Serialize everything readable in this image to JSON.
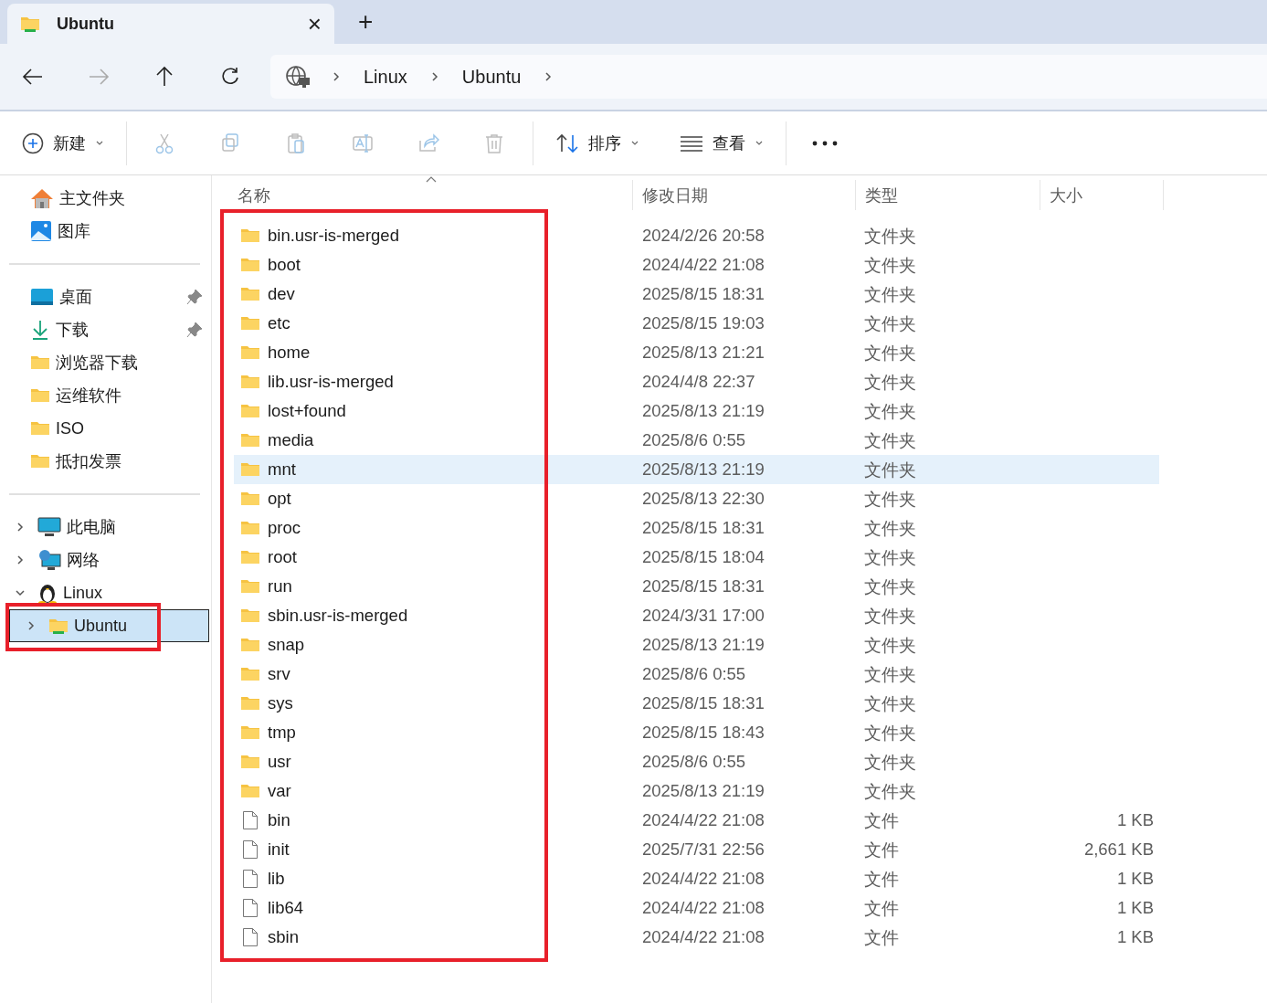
{
  "tab": {
    "title": "Ubuntu",
    "close": "×",
    "new_tab": "+"
  },
  "navigation": {
    "forward_disabled": true
  },
  "breadcrumb": [
    "Linux",
    "Ubuntu"
  ],
  "toolbar": {
    "new": "新建",
    "sort": "排序",
    "view": "查看",
    "actions": [
      {
        "kind": "cut",
        "disabled": true
      },
      {
        "kind": "copy",
        "disabled": true
      },
      {
        "kind": "paste",
        "disabled": true
      },
      {
        "kind": "rename",
        "disabled": true
      },
      {
        "kind": "share",
        "disabled": true
      },
      {
        "kind": "delete",
        "disabled": true
      }
    ]
  },
  "sidebar": {
    "top": [
      {
        "label": "主文件夹",
        "kind": "home"
      },
      {
        "label": "图库",
        "kind": "gallery"
      }
    ],
    "quick_access": [
      {
        "label": "桌面",
        "kind": "desktop",
        "pinned": true
      },
      {
        "label": "下载",
        "kind": "download",
        "pinned": true
      },
      {
        "label": "浏览器下载",
        "kind": "folder",
        "pinned": false
      },
      {
        "label": "运维软件",
        "kind": "folder",
        "pinned": false
      },
      {
        "label": "ISO",
        "kind": "folder",
        "pinned": false
      },
      {
        "label": "抵扣发票",
        "kind": "folder",
        "pinned": false
      }
    ],
    "tree": [
      {
        "label": "此电脑",
        "kind": "pc",
        "expanded": false,
        "selected": false
      },
      {
        "label": "网络",
        "kind": "network",
        "expanded": false,
        "selected": false
      },
      {
        "label": "Linux",
        "kind": "linux",
        "expanded": true,
        "selected": false,
        "children": [
          {
            "label": "Ubuntu",
            "kind": "drive",
            "expanded": false,
            "selected": true
          }
        ]
      }
    ]
  },
  "table": {
    "columns": [
      "名称",
      "修改日期",
      "类型",
      "大小"
    ],
    "rows": [
      {
        "name": "bin.usr-is-merged",
        "date": "2024/2/26 20:58",
        "type": "文件夹",
        "kind": "folder",
        "selected": false
      },
      {
        "name": "boot",
        "date": "2024/4/22 21:08",
        "type": "文件夹",
        "kind": "folder",
        "selected": false
      },
      {
        "name": "dev",
        "date": "2025/8/15 18:31",
        "type": "文件夹",
        "kind": "folder",
        "selected": false
      },
      {
        "name": "etc",
        "date": "2025/8/15 19:03",
        "type": "文件夹",
        "kind": "folder",
        "selected": false
      },
      {
        "name": "home",
        "date": "2025/8/13 21:21",
        "type": "文件夹",
        "kind": "folder",
        "selected": false
      },
      {
        "name": "lib.usr-is-merged",
        "date": "2024/4/8 22:37",
        "type": "文件夹",
        "kind": "folder",
        "selected": false
      },
      {
        "name": "lost+found",
        "date": "2025/8/13 21:19",
        "type": "文件夹",
        "kind": "folder",
        "selected": false
      },
      {
        "name": "media",
        "date": "2025/8/6 0:55",
        "type": "文件夹",
        "kind": "folder",
        "selected": false
      },
      {
        "name": "mnt",
        "date": "2025/8/13 21:19",
        "type": "文件夹",
        "kind": "folder",
        "selected": true
      },
      {
        "name": "opt",
        "date": "2025/8/13 22:30",
        "type": "文件夹",
        "kind": "folder",
        "selected": false
      },
      {
        "name": "proc",
        "date": "2025/8/15 18:31",
        "type": "文件夹",
        "kind": "folder",
        "selected": false
      },
      {
        "name": "root",
        "date": "2025/8/15 18:04",
        "type": "文件夹",
        "kind": "folder",
        "selected": false
      },
      {
        "name": "run",
        "date": "2025/8/15 18:31",
        "type": "文件夹",
        "kind": "folder",
        "selected": false
      },
      {
        "name": "sbin.usr-is-merged",
        "date": "2024/3/31 17:00",
        "type": "文件夹",
        "kind": "folder",
        "selected": false
      },
      {
        "name": "snap",
        "date": "2025/8/13 21:19",
        "type": "文件夹",
        "kind": "folder",
        "selected": false
      },
      {
        "name": "srv",
        "date": "2025/8/6 0:55",
        "type": "文件夹",
        "kind": "folder",
        "selected": false
      },
      {
        "name": "sys",
        "date": "2025/8/15 18:31",
        "type": "文件夹",
        "kind": "folder",
        "selected": false
      },
      {
        "name": "tmp",
        "date": "2025/8/15 18:43",
        "type": "文件夹",
        "kind": "folder",
        "selected": false
      },
      {
        "name": "usr",
        "date": "2025/8/6 0:55",
        "type": "文件夹",
        "kind": "folder",
        "selected": false
      },
      {
        "name": "var",
        "date": "2025/8/13 21:19",
        "type": "文件夹",
        "kind": "folder",
        "selected": false
      },
      {
        "name": "bin",
        "date": "2024/4/22 21:08",
        "type": "文件",
        "size": "1 KB",
        "kind": "file",
        "selected": false
      },
      {
        "name": "init",
        "date": "2025/7/31 22:56",
        "type": "文件",
        "size": "2,661 KB",
        "kind": "file",
        "selected": false
      },
      {
        "name": "lib",
        "date": "2024/4/22 21:08",
        "type": "文件",
        "size": "1 KB",
        "kind": "file",
        "selected": false
      },
      {
        "name": "lib64",
        "date": "2024/4/22 21:08",
        "type": "文件",
        "size": "1 KB",
        "kind": "file",
        "selected": false
      },
      {
        "name": "sbin",
        "date": "2024/4/22 21:08",
        "type": "文件",
        "size": "1 KB",
        "kind": "file",
        "selected": false
      }
    ]
  }
}
